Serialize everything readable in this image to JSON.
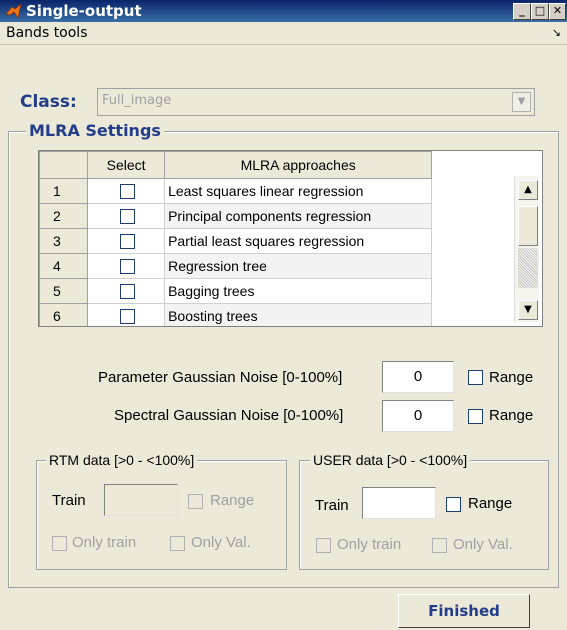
{
  "window": {
    "title": "Single-output"
  },
  "menu": {
    "bands_tools": "Bands tools"
  },
  "class_row": {
    "label": "Class:",
    "value": "Full_image"
  },
  "mlra": {
    "title": "MLRA Settings",
    "headers": {
      "select": "Select",
      "approaches": "MLRA approaches"
    },
    "rows": [
      {
        "n": "1",
        "name": "Least squares linear regression"
      },
      {
        "n": "2",
        "name": "Principal components regression"
      },
      {
        "n": "3",
        "name": "Partial least squares regression"
      },
      {
        "n": "4",
        "name": "Regression tree"
      },
      {
        "n": "5",
        "name": "Bagging trees"
      },
      {
        "n": "6",
        "name": "Boosting trees"
      }
    ]
  },
  "noise": {
    "parameter_label": "Parameter Gaussian Noise  [0-100%]",
    "parameter_value": "0",
    "spectral_label": "Spectral Gaussian Noise  [0-100%]",
    "spectral_value": "0",
    "range_label": "Range"
  },
  "rtm": {
    "title": "RTM data [>0 - <100%]",
    "train_label": "Train",
    "train_value": "",
    "range_label": "Range",
    "only_train": "Only train",
    "only_val": "Only Val."
  },
  "user": {
    "title": "USER data [>0 - <100%]",
    "train_label": "Train",
    "train_value": "",
    "range_label": "Range",
    "only_train": "Only train",
    "only_val": "Only Val."
  },
  "finished_label": "Finished"
}
